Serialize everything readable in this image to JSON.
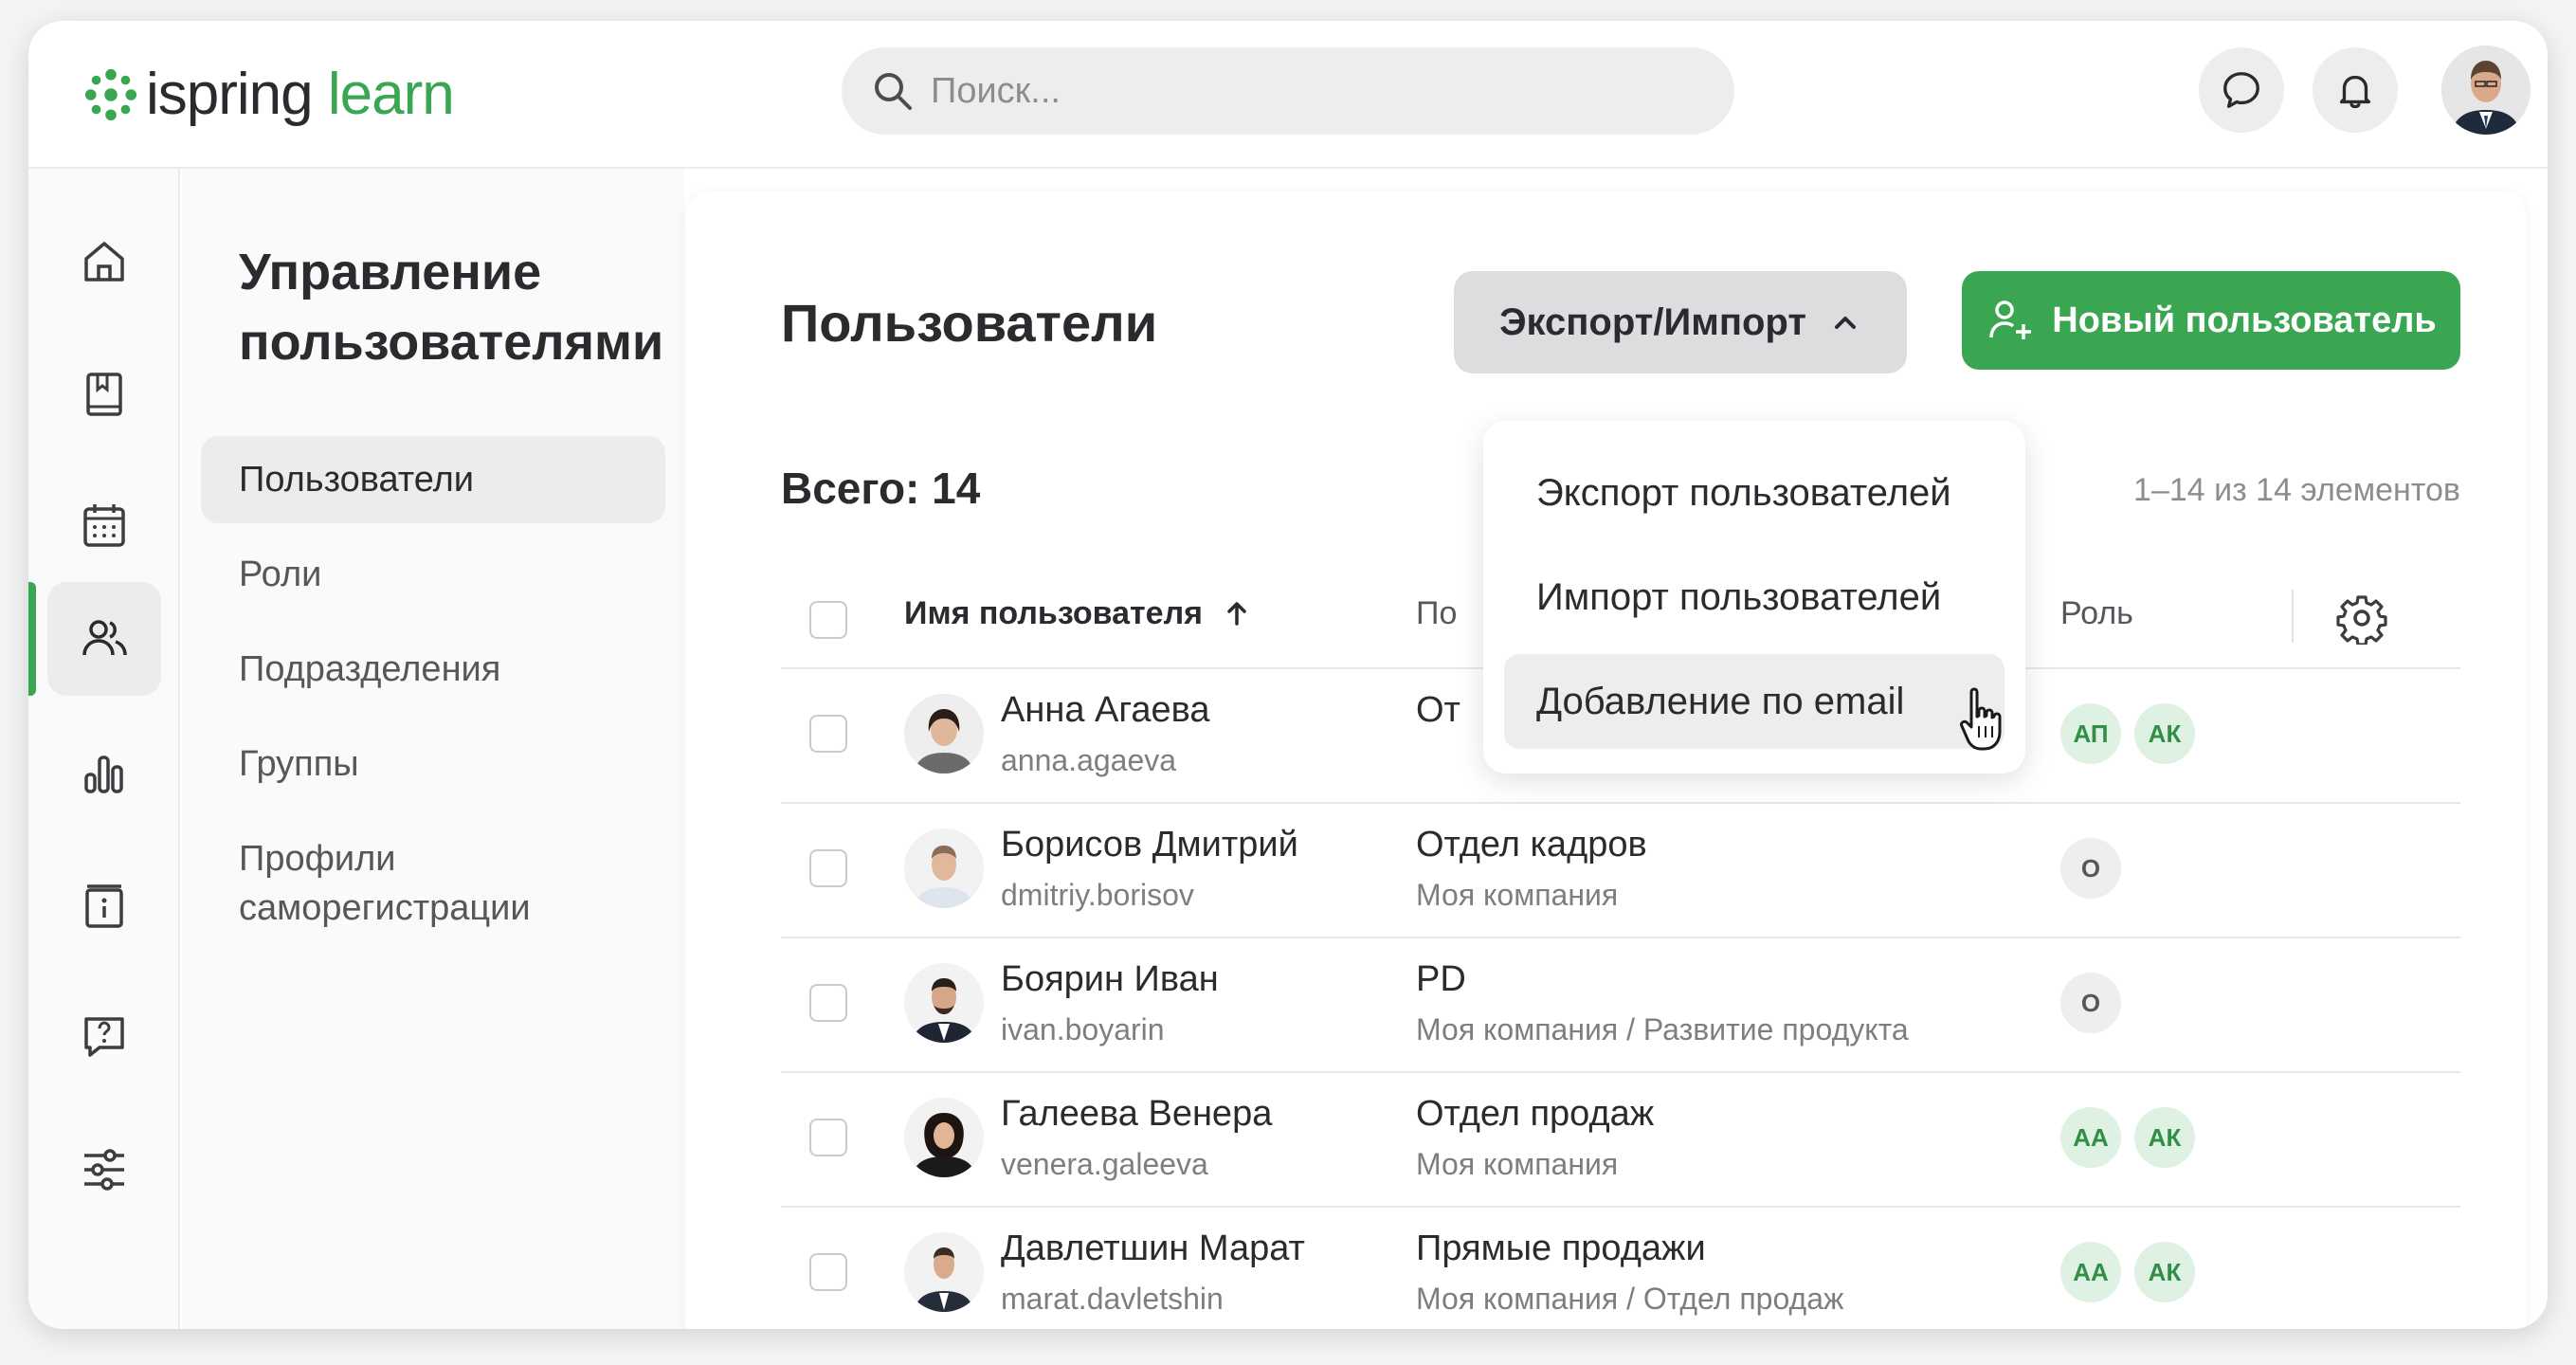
{
  "app": {
    "logo_part1": "ispring",
    "logo_part2": "learn",
    "brand_color": "#3aa652"
  },
  "search": {
    "placeholder": "Поиск..."
  },
  "topbar": {
    "icons": [
      "chat-icon",
      "bell-icon",
      "user-avatar"
    ]
  },
  "rail": {
    "items": [
      "home-icon",
      "book-icon",
      "calendar-icon",
      "users-icon",
      "chart-icon",
      "info-icon",
      "help-icon",
      "settings-sliders-icon"
    ],
    "active": "users-icon"
  },
  "subnav": {
    "title": "Управление пользователями",
    "items": [
      {
        "label": "Пользователи"
      },
      {
        "label": "Роли"
      },
      {
        "label": "Подразделения"
      },
      {
        "label": "Группы"
      },
      {
        "label": "Профили саморегистрации"
      }
    ]
  },
  "main": {
    "title": "Пользователи",
    "export_label": "Экспорт/Импорт",
    "new_user_label": "Новый пользователь",
    "total": "Всего: 14",
    "pagination": "1–14 из 14 элементов",
    "columns": {
      "name": "Имя пользователя",
      "dept": "По",
      "role": "Роль"
    }
  },
  "dropdown": {
    "items": [
      {
        "label": "Экспорт пользователей"
      },
      {
        "label": "Импорт пользователей"
      },
      {
        "label": "Добавление по email"
      }
    ]
  },
  "rows": [
    {
      "name": "Анна Агаева",
      "login": "anna.agaeva",
      "dept": "От",
      "dept_sub": "",
      "badges": [
        "АП",
        "АК"
      ]
    },
    {
      "name": "Борисов Дмитрий",
      "login": "dmitriy.borisov",
      "dept": "Отдел кадров",
      "dept_sub": "Моя компания",
      "badges": [
        "О"
      ]
    },
    {
      "name": "Боярин Иван",
      "login": "ivan.boyarin",
      "dept": "PD",
      "dept_sub": "Моя компания / Развитие продукта",
      "badges": [
        "О"
      ]
    },
    {
      "name": "Галеева Венера",
      "login": "venera.galeeva",
      "dept": "Отдел продаж",
      "dept_sub": "Моя компания",
      "badges": [
        "АА",
        "АК"
      ]
    },
    {
      "name": "Давлетшин Марат",
      "login": "marat.davletshin",
      "dept": "Прямые продажи",
      "dept_sub": "Моя компания / Отдел продаж",
      "badges": [
        "АА",
        "АК"
      ]
    }
  ]
}
